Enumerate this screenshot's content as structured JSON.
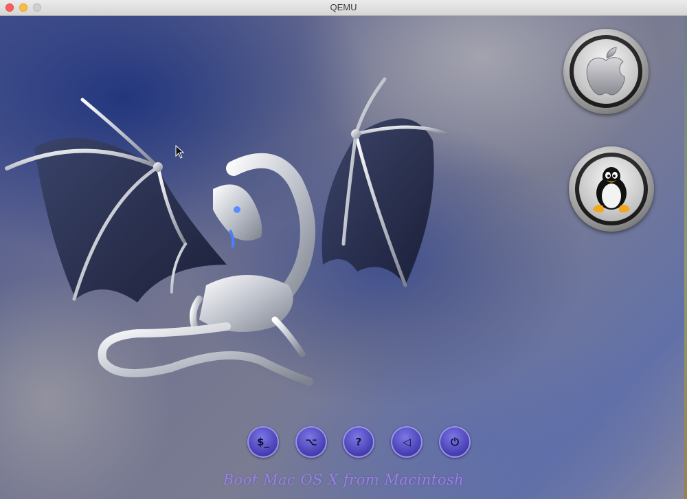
{
  "window": {
    "title": "QEMU"
  },
  "boot_menu": {
    "entries": [
      {
        "name": "macos",
        "icon": "apple-logo-icon"
      },
      {
        "name": "linux",
        "icon": "tux-penguin-icon"
      }
    ],
    "selected_label": "Boot Mac OS X from Macintosh"
  },
  "toolbar": {
    "buttons": [
      {
        "name": "shell",
        "icon": "terminal-icon",
        "glyph": "$_"
      },
      {
        "name": "options",
        "icon": "options-icon",
        "glyph": "⌥"
      },
      {
        "name": "help",
        "icon": "help-icon",
        "glyph": "?"
      },
      {
        "name": "reset-nvram",
        "icon": "back-triangle-icon",
        "glyph": "◁"
      },
      {
        "name": "shutdown",
        "icon": "power-icon",
        "glyph": "⏻"
      }
    ]
  },
  "colors": {
    "accent_purple": "#4941b5",
    "label_purple": "#9a82e0"
  }
}
